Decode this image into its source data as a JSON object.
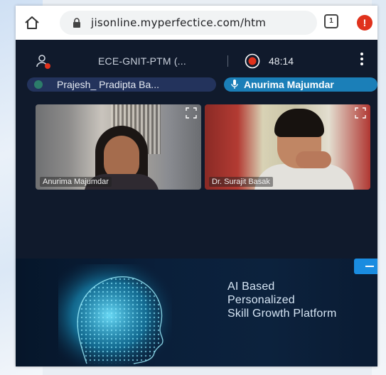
{
  "browser": {
    "url": "jisonline.myperfectice.com/htm",
    "tab_count": "1"
  },
  "meeting": {
    "title": "ECE-GNIT-PTM (...",
    "timer": "48:14",
    "recording": true
  },
  "participants_bar": [
    {
      "label": "Prajesh_ Pradipta Ba..."
    },
    {
      "label": "Anurima Majumdar",
      "speaking": true
    }
  ],
  "video_tiles": [
    {
      "name": "Anurima Majumdar"
    },
    {
      "name": "Dr. Surajit Basak"
    }
  ],
  "banner": {
    "line1": "AI Based",
    "line2": "Personalized",
    "line3": "Skill Growth Platform"
  },
  "colors": {
    "app_bg": "#101a2c",
    "speaking_chip": "#1b7fb8",
    "record": "#e0321c"
  },
  "icons": [
    "home-icon",
    "lock-icon",
    "tabs-icon",
    "alert-icon",
    "people-icon",
    "record-icon",
    "more-menu-icon",
    "mic-icon",
    "expand-icon"
  ]
}
